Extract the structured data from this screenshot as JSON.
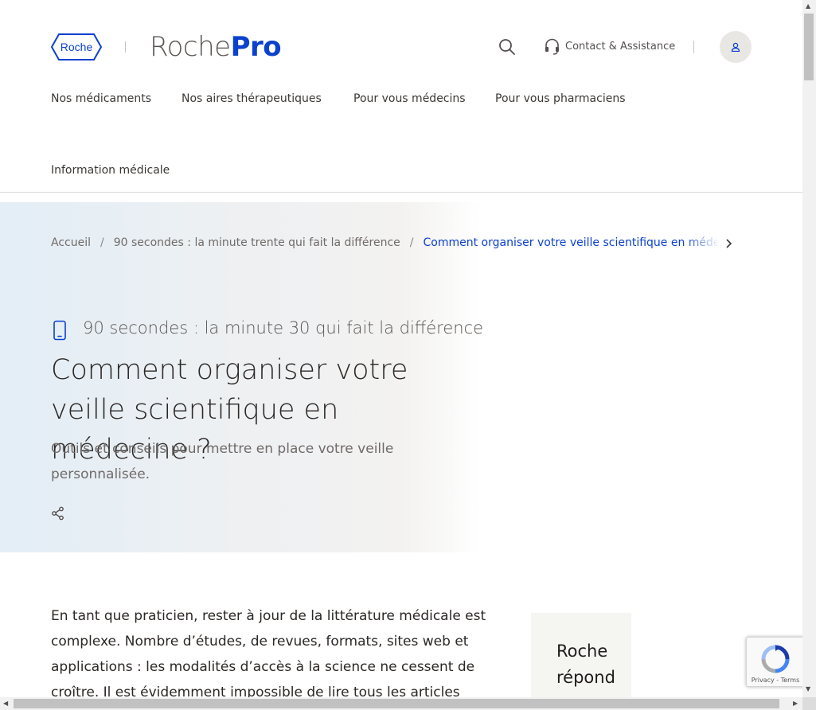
{
  "header": {
    "brand_logo_text": "Roche",
    "brand_part1": "Roche",
    "brand_part2": "Pro",
    "contact_label": "Contact & Assistance"
  },
  "nav": {
    "items": [
      {
        "label": "Nos médicaments"
      },
      {
        "label": "Nos aires thérapeutiques"
      },
      {
        "label": "Pour vous médecins"
      },
      {
        "label": "Pour vous pharmaciens"
      },
      {
        "label": "Information médicale"
      }
    ]
  },
  "breadcrumb": {
    "items": [
      {
        "label": "Accueil"
      },
      {
        "label": "90 secondes : la minute trente qui fait la différence"
      },
      {
        "label": "Comment organiser votre veille scientifique en médecine ?"
      }
    ],
    "separator": "/"
  },
  "hero": {
    "category": "90 secondes : la minute 30 qui fait la différence",
    "title": "Comment organiser votre veille scientifique en médecine ?",
    "subtitle": "Outils et conseils pour mettre en place votre veille personnalisée."
  },
  "article": {
    "intro": "En tant que praticien, rester à jour de la littérature médicale est complexe. Nombre d’études, de revues, formats, sites web et applications : les modalités d’accès à la science ne cessent de croître. Il est évidemment impossible de lire tous les articles pertinents publiés"
  },
  "aside": {
    "title": "Roche répond"
  },
  "recaptcha": {
    "terms": "Privacy - Terms"
  },
  "scrollbar": {
    "up": "▲",
    "down": "▼",
    "left": "◀",
    "right": "▶"
  },
  "colors": {
    "brand_blue": "#0b41cd",
    "text_dark": "#2b2725",
    "text_muted": "#706b69",
    "hero_gradient_start": "#e3eef6"
  }
}
